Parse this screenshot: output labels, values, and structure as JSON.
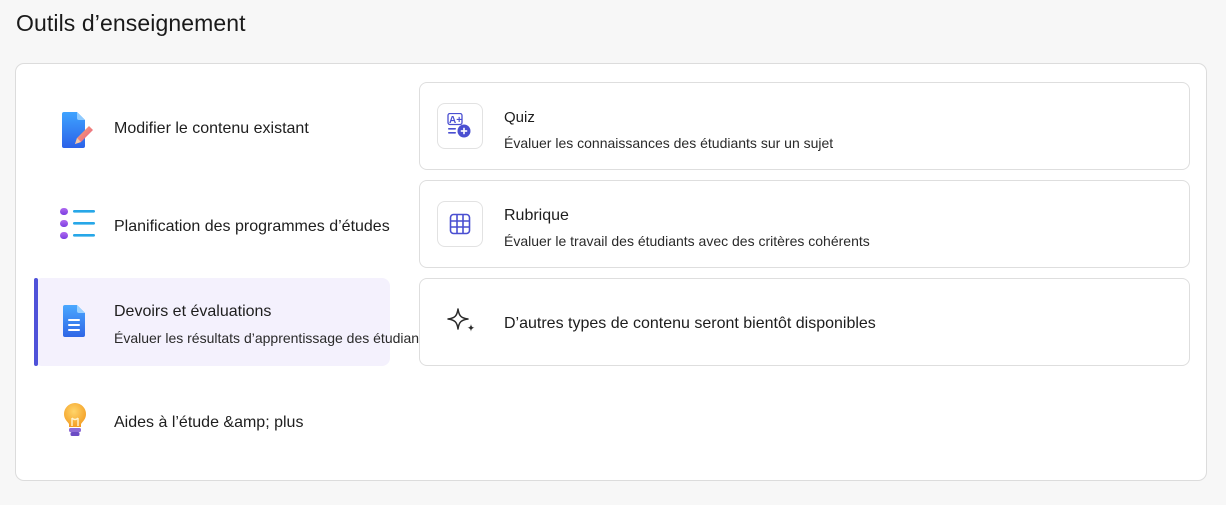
{
  "page_title": "Outils d’enseignement",
  "sidebar": {
    "items": [
      {
        "label": "Modifier le contenu existant",
        "icon": "document-edit-icon"
      },
      {
        "label": "Planification des programmes d’études",
        "icon": "list-icon"
      },
      {
        "label": "Devoirs et évaluations",
        "sublabel": "Évaluer les résultats d’apprentissage des étudiants",
        "icon": "document-text-icon",
        "active": true
      },
      {
        "label": "Aides à l’étude &amp; plus",
        "icon": "lightbulb-icon"
      }
    ]
  },
  "cards": [
    {
      "title": "Quiz",
      "description": "Évaluer les connaissances des étudiants sur un sujet",
      "icon": "quiz-icon"
    },
    {
      "title": "Rubrique",
      "description": "Évaluer le travail des étudiants avec des critères cohérents",
      "icon": "table-grid-icon"
    },
    {
      "description": "D’autres types de contenu seront bientôt disponibles",
      "icon": "sparkle-icon"
    }
  ],
  "colors": {
    "accent": "#4f52d9",
    "active_bg": "#f4f1fd",
    "icon_blue": "#4a4fd1"
  }
}
